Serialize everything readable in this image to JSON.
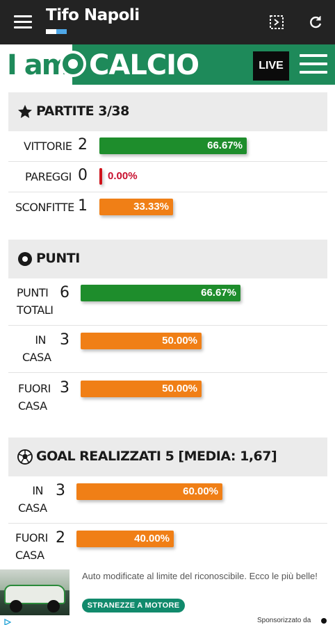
{
  "appbar": {
    "title": "Tifo Napoli",
    "actions": [
      "fullscreen-icon",
      "refresh-icon"
    ]
  },
  "brand": {
    "logo_left": "I am",
    "logo_right": "CALCIO",
    "live_label": "LIVE",
    "colors": {
      "green": "#1e8a5a",
      "live_bg": "#0b0b0b"
    }
  },
  "sections": {
    "partite": {
      "title": "PARTITE 3/38",
      "icon": "star-icon",
      "rows": [
        {
          "label": "VITTORIE",
          "value": "2",
          "percent": "66.67%",
          "fraction": 0.6667,
          "color": "#1e8d2c"
        },
        {
          "label": "PAREGGI",
          "value": "0",
          "percent": "0.00%",
          "fraction": 0,
          "color": "#d0131b"
        },
        {
          "label": "SCONFITTE",
          "value": "1",
          "percent": "33.33%",
          "fraction": 0.3333,
          "color": "#f07f16"
        }
      ]
    },
    "punti": {
      "title": "PUNTI",
      "icon": "circle-dot-icon",
      "rows": [
        {
          "label_line1": "PUNTI",
          "label_line2": "TOTALI",
          "value": "6",
          "percent": "66.67%",
          "fraction": 0.6667,
          "color": "#1e8d2c"
        },
        {
          "label_line1": "IN",
          "label_line2": "CASA",
          "value": "3",
          "percent": "50.00%",
          "fraction": 0.5,
          "color": "#f07f16"
        },
        {
          "label_line1": "FUORI",
          "label_line2": "CASA",
          "value": "3",
          "percent": "50.00%",
          "fraction": 0.5,
          "color": "#f07f16"
        }
      ]
    },
    "goal": {
      "title": "GOAL REALIZZATI 5 [MEDIA: 1,67]",
      "icon": "soccer-ball-icon",
      "rows": [
        {
          "label_line1": "IN",
          "label_line2": "CASA",
          "value": "3",
          "percent": "60.00%",
          "fraction": 0.6,
          "color": "#f07f16"
        },
        {
          "label_line1": "FUORI",
          "label_line2": "CASA",
          "value": "2",
          "percent": "40.00%",
          "fraction": 0.4,
          "color": "#f07f16"
        }
      ]
    }
  },
  "ad": {
    "text": "Auto modificate al limite del riconoscibile. Ecco le più belle!",
    "cta": "STRANEZZE A MOTORE",
    "sponsored": "Sponsorizzato da"
  }
}
